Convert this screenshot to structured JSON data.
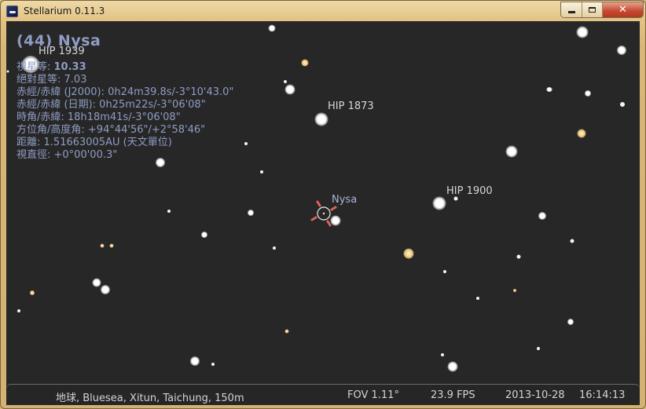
{
  "window": {
    "title": "Stellarium 0.11.3",
    "close_label": "✕"
  },
  "object_info": {
    "name": "(44) Nysa",
    "lines": [
      {
        "label": "視星等: ",
        "value": "10.33"
      },
      {
        "label": "絕對星等: ",
        "value": "7.03"
      },
      {
        "label": "赤經/赤緯 (J2000): ",
        "value": "0h24m39.8s/-3°10'43.0\""
      },
      {
        "label": "赤經/赤緯 (日期): ",
        "value": "0h25m22s/-3°06'08\""
      },
      {
        "label": "時角/赤緯: ",
        "value": "18h18m41s/-3°06'08\""
      },
      {
        "label": "方位角/高度角: ",
        "value": "+94°44'56\"/+2°58'46\""
      },
      {
        "label": "距離: ",
        "value": "1.51663005AU (天文單位)"
      },
      {
        "label": "視直徑: ",
        "value": "+0°00'00.3\""
      }
    ]
  },
  "sky_labels": {
    "hip1939": "HIP 1939",
    "hip1873": "HIP 1873",
    "hip1900": "HIP 1900",
    "nysa": "Nysa"
  },
  "status": {
    "location": "地球, Bluesea, Xitun, Taichung, 150m",
    "fov": "FOV 1.11°",
    "fps": "23.9 FPS",
    "date": "2013-10-28",
    "time": "16:14:13"
  },
  "colors": {
    "sky": "#272727",
    "info_text": "#8f9dc4",
    "selection_marker": "#e0605a"
  }
}
